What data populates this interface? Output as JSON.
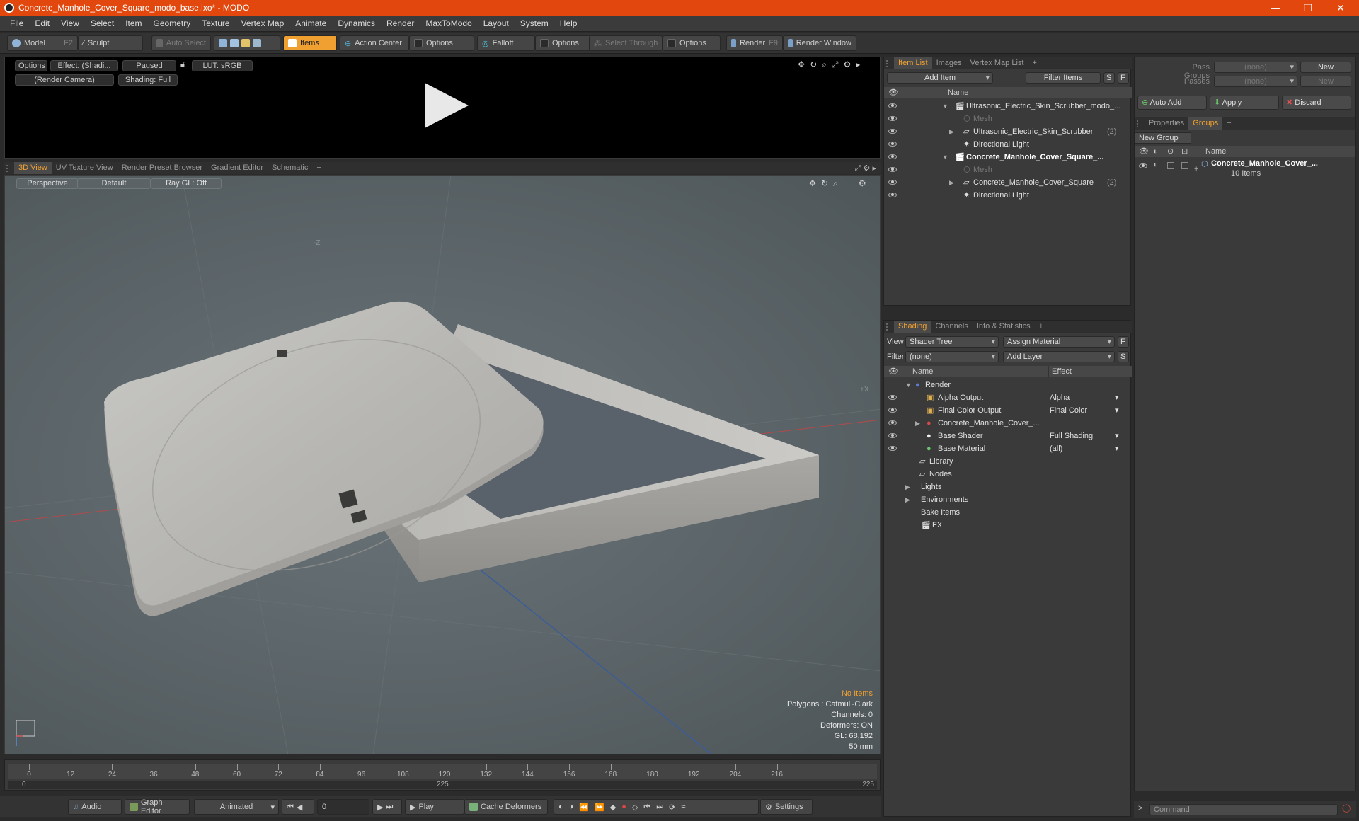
{
  "window": {
    "title": "Concrete_Manhole_Cover_Square_modo_base.lxo* - MODO"
  },
  "menu": [
    "File",
    "Edit",
    "View",
    "Select",
    "Item",
    "Geometry",
    "Texture",
    "Vertex Map",
    "Animate",
    "Dynamics",
    "Render",
    "MaxToModo",
    "Layout",
    "System",
    "Help"
  ],
  "toolbar": {
    "model": "Model",
    "model_key": "F2",
    "sculpt": "Sculpt",
    "auto_select": "Auto Select",
    "items": "Items",
    "action_center": "Action Center",
    "options1": "Options",
    "falloff": "Falloff",
    "options2": "Options",
    "select_through": "Select Through",
    "options3": "Options",
    "render": "Render",
    "render_key": "F9",
    "render_window": "Render Window"
  },
  "preview": {
    "options": "Options",
    "effect": "Effect: (Shadi...",
    "paused": "Paused",
    "lut": "LUT: sRGB",
    "camera": "(Render Camera)",
    "shading": "Shading: Full"
  },
  "viewport_tabs": [
    "3D View",
    "UV Texture View",
    "Render Preset Browser",
    "Gradient Editor",
    "Schematic",
    "+"
  ],
  "viewport": {
    "perspective": "Perspective",
    "default": "Default",
    "raygl": "Ray GL: Off",
    "axis_z": "-Z",
    "axis_x": "+X",
    "stats": {
      "no_items": "No Items",
      "polygons": "Polygons : Catmull-Clark",
      "channels": "Channels: 0",
      "deformers": "Deformers: ON",
      "gl": "GL: 68,192",
      "mm": "50 mm"
    }
  },
  "timeline": {
    "ticks": [
      "0",
      "12",
      "24",
      "36",
      "48",
      "60",
      "72",
      "84",
      "96",
      "108",
      "120",
      "132",
      "144",
      "156",
      "168",
      "180",
      "192",
      "204",
      "216"
    ],
    "start": "0",
    "mid": "225",
    "end": "225"
  },
  "bottombar": {
    "audio": "Audio",
    "graph_editor": "Graph Editor",
    "animated": "Animated",
    "frame": "0",
    "play": "Play",
    "cache_deformers": "Cache Deformers",
    "settings": "Settings"
  },
  "item_list": {
    "tabs": [
      "Item List",
      "Images",
      "Vertex Map List",
      "+"
    ],
    "add_item": "Add Item",
    "filter_items": "Filter Items",
    "s": "S",
    "f": "F",
    "name_header": "Name",
    "rows": [
      {
        "label": "Ultrasonic_Electric_Skin_Scrubber_modo_...",
        "count": ""
      },
      {
        "label": "Mesh",
        "count": ""
      },
      {
        "label": "Ultrasonic_Electric_Skin_Scrubber",
        "count": "(2)"
      },
      {
        "label": "Directional Light",
        "count": ""
      },
      {
        "label": "Concrete_Manhole_Cover_Square_...",
        "count": ""
      },
      {
        "label": "Mesh",
        "count": ""
      },
      {
        "label": "Concrete_Manhole_Cover_Square",
        "count": "(2)"
      },
      {
        "label": "Directional Light",
        "count": ""
      }
    ]
  },
  "shading": {
    "tabs": [
      "Shading",
      "Channels",
      "Info & Statistics",
      "+"
    ],
    "view_label": "View",
    "view_value": "Shader Tree",
    "assign_material": "Assign Material",
    "filter_label": "Filter",
    "filter_value": "(none)",
    "add_layer": "Add Layer",
    "f": "F",
    "s": "S",
    "name_header": "Name",
    "effect_header": "Effect",
    "rows": [
      {
        "label": "Render",
        "effect": ""
      },
      {
        "label": "Alpha Output",
        "effect": "Alpha"
      },
      {
        "label": "Final Color Output",
        "effect": "Final Color"
      },
      {
        "label": "Concrete_Manhole_Cover_...",
        "effect": ""
      },
      {
        "label": "Base Shader",
        "effect": "Full Shading"
      },
      {
        "label": "Base Material",
        "effect": "(all)"
      },
      {
        "label": "Library",
        "effect": ""
      },
      {
        "label": "Nodes",
        "effect": ""
      },
      {
        "label": "Lights",
        "effect": ""
      },
      {
        "label": "Environments",
        "effect": ""
      },
      {
        "label": "Bake Items",
        "effect": ""
      },
      {
        "label": "FX",
        "effect": ""
      }
    ]
  },
  "groups_panel": {
    "pass_groups_label": "Pass Groups",
    "pass_groups_value": "(none)",
    "new": "New",
    "passes_label": "Passes",
    "passes_value": "(none)",
    "new2": "New",
    "auto_add": "Auto Add",
    "apply": "Apply",
    "discard": "Discard",
    "tabs": [
      "Properties",
      "Groups",
      "+"
    ],
    "new_group": "New Group",
    "name_header": "Name",
    "group_name": "Concrete_Manhole_Cover_...",
    "group_count": "10 Items"
  },
  "command": {
    "placeholder": "Command",
    "prompt": ">"
  },
  "colors": {
    "accent": "#f0a030",
    "titlebar": "#e2470d"
  }
}
